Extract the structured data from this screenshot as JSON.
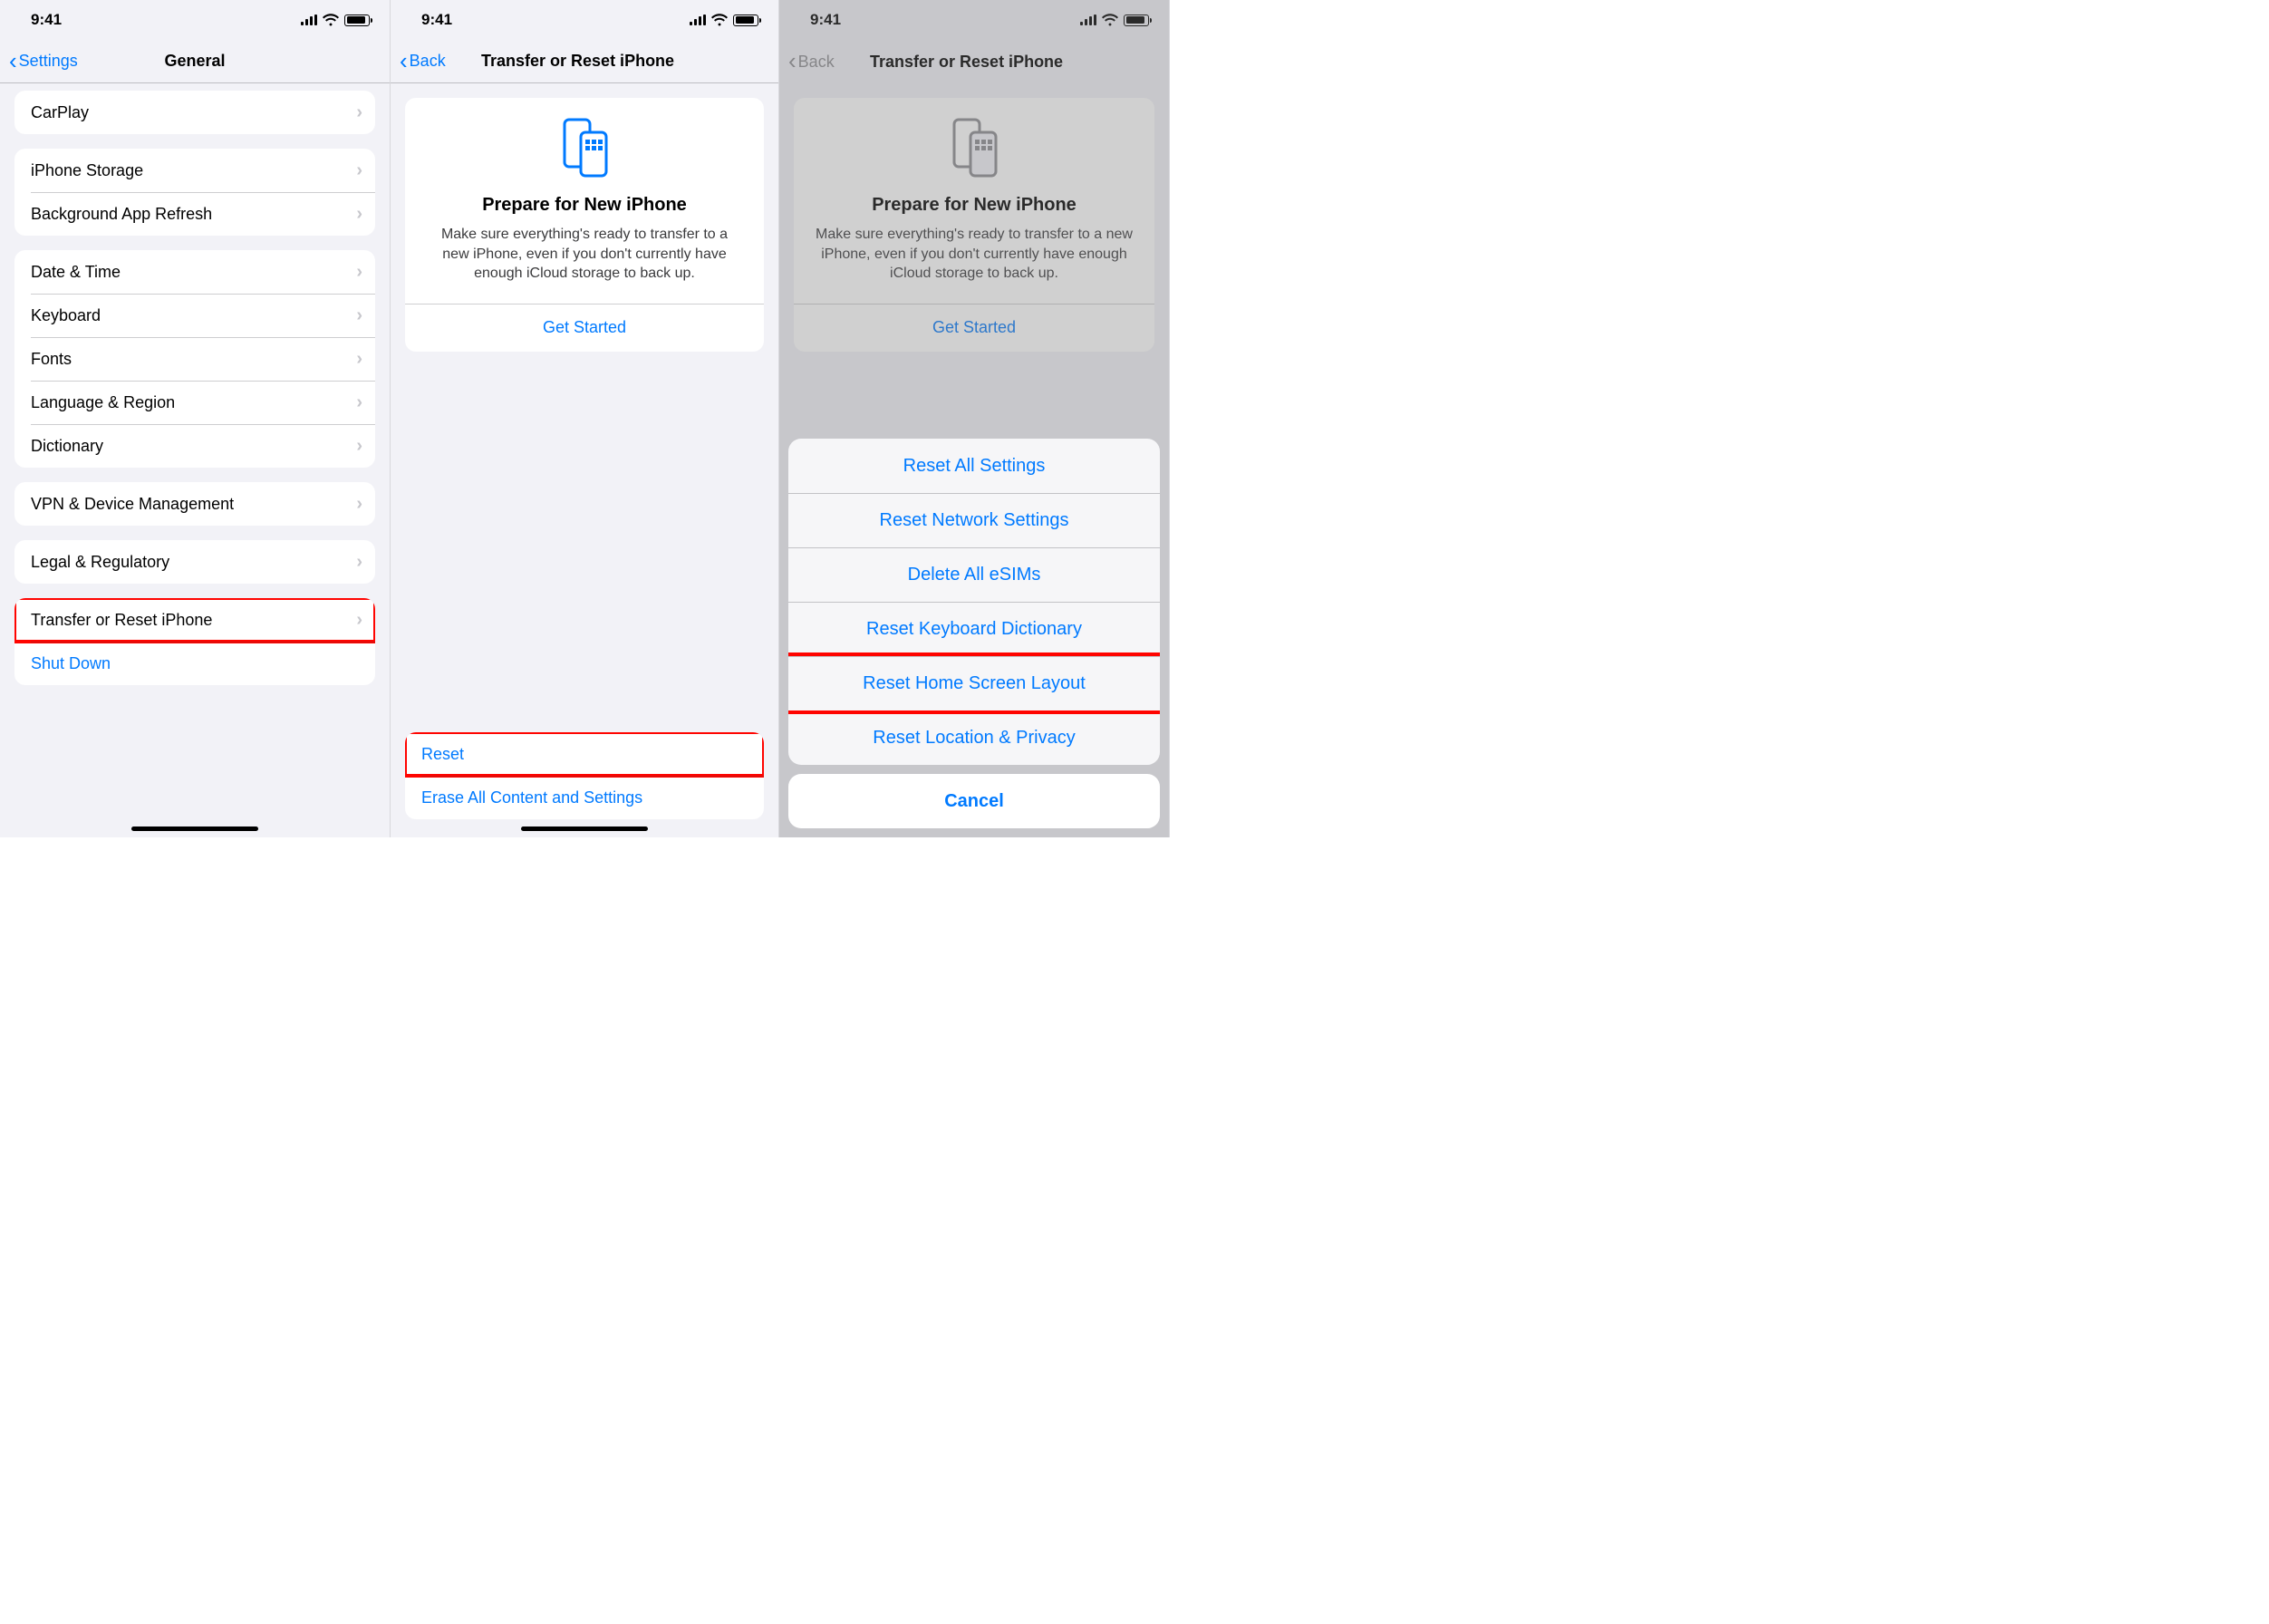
{
  "status": {
    "time": "9:41"
  },
  "p1": {
    "back": "Settings",
    "title": "General",
    "groups": [
      {
        "items": [
          {
            "label": "CarPlay"
          }
        ]
      },
      {
        "items": [
          {
            "label": "iPhone Storage"
          },
          {
            "label": "Background App Refresh"
          }
        ]
      },
      {
        "items": [
          {
            "label": "Date & Time"
          },
          {
            "label": "Keyboard"
          },
          {
            "label": "Fonts"
          },
          {
            "label": "Language & Region"
          },
          {
            "label": "Dictionary"
          }
        ]
      },
      {
        "items": [
          {
            "label": "VPN & Device Management"
          }
        ]
      },
      {
        "items": [
          {
            "label": "Legal & Regulatory"
          }
        ]
      },
      {
        "items": [
          {
            "label": "Transfer or Reset iPhone",
            "highlight": true
          },
          {
            "label": "Shut Down",
            "blue": true,
            "noChevron": true
          }
        ]
      }
    ]
  },
  "p2": {
    "back": "Back",
    "title": "Transfer or Reset iPhone",
    "card": {
      "title": "Prepare for New iPhone",
      "desc": "Make sure everything's ready to transfer to a new iPhone, even if you don't currently have enough iCloud storage to back up.",
      "action": "Get Started"
    },
    "bottom": [
      {
        "label": "Reset",
        "highlight": true
      },
      {
        "label": "Erase All Content and Settings"
      }
    ]
  },
  "p3": {
    "back": "Back",
    "title": "Transfer or Reset iPhone",
    "card": {
      "title": "Prepare for New iPhone",
      "desc": "Make sure everything's ready to transfer to a new iPhone, even if you don't currently have enough iCloud storage to back up.",
      "action": "Get Started"
    },
    "sheet": {
      "items": [
        "Reset All Settings",
        "Reset Network Settings",
        "Delete All eSIMs",
        "Reset Keyboard Dictionary",
        "Reset Home Screen Layout",
        "Reset Location & Privacy"
      ],
      "highlightIndex": 4,
      "cancel": "Cancel"
    }
  }
}
